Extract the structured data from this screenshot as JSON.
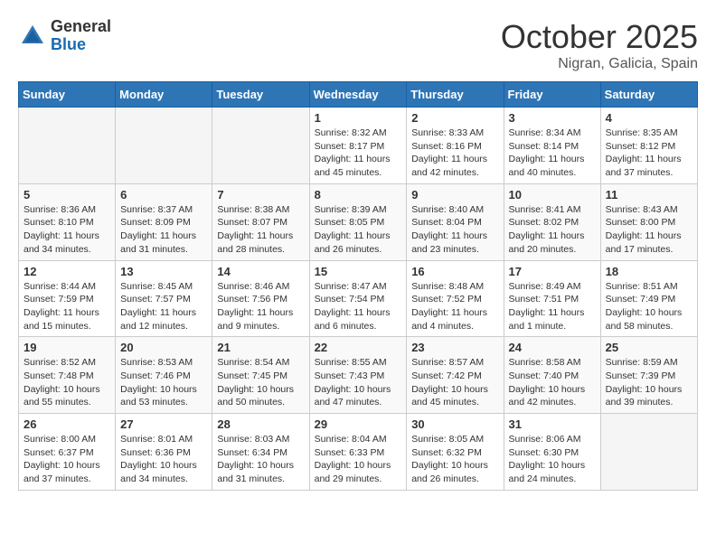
{
  "header": {
    "logo": {
      "general": "General",
      "blue": "Blue"
    },
    "title": "October 2025",
    "location": "Nigran, Galicia, Spain"
  },
  "weekdays": [
    "Sunday",
    "Monday",
    "Tuesday",
    "Wednesday",
    "Thursday",
    "Friday",
    "Saturday"
  ],
  "weeks": [
    [
      {
        "day": "",
        "info": ""
      },
      {
        "day": "",
        "info": ""
      },
      {
        "day": "",
        "info": ""
      },
      {
        "day": "1",
        "info": "Sunrise: 8:32 AM\nSunset: 8:17 PM\nDaylight: 11 hours and 45 minutes."
      },
      {
        "day": "2",
        "info": "Sunrise: 8:33 AM\nSunset: 8:16 PM\nDaylight: 11 hours and 42 minutes."
      },
      {
        "day": "3",
        "info": "Sunrise: 8:34 AM\nSunset: 8:14 PM\nDaylight: 11 hours and 40 minutes."
      },
      {
        "day": "4",
        "info": "Sunrise: 8:35 AM\nSunset: 8:12 PM\nDaylight: 11 hours and 37 minutes."
      }
    ],
    [
      {
        "day": "5",
        "info": "Sunrise: 8:36 AM\nSunset: 8:10 PM\nDaylight: 11 hours and 34 minutes."
      },
      {
        "day": "6",
        "info": "Sunrise: 8:37 AM\nSunset: 8:09 PM\nDaylight: 11 hours and 31 minutes."
      },
      {
        "day": "7",
        "info": "Sunrise: 8:38 AM\nSunset: 8:07 PM\nDaylight: 11 hours and 28 minutes."
      },
      {
        "day": "8",
        "info": "Sunrise: 8:39 AM\nSunset: 8:05 PM\nDaylight: 11 hours and 26 minutes."
      },
      {
        "day": "9",
        "info": "Sunrise: 8:40 AM\nSunset: 8:04 PM\nDaylight: 11 hours and 23 minutes."
      },
      {
        "day": "10",
        "info": "Sunrise: 8:41 AM\nSunset: 8:02 PM\nDaylight: 11 hours and 20 minutes."
      },
      {
        "day": "11",
        "info": "Sunrise: 8:43 AM\nSunset: 8:00 PM\nDaylight: 11 hours and 17 minutes."
      }
    ],
    [
      {
        "day": "12",
        "info": "Sunrise: 8:44 AM\nSunset: 7:59 PM\nDaylight: 11 hours and 15 minutes."
      },
      {
        "day": "13",
        "info": "Sunrise: 8:45 AM\nSunset: 7:57 PM\nDaylight: 11 hours and 12 minutes."
      },
      {
        "day": "14",
        "info": "Sunrise: 8:46 AM\nSunset: 7:56 PM\nDaylight: 11 hours and 9 minutes."
      },
      {
        "day": "15",
        "info": "Sunrise: 8:47 AM\nSunset: 7:54 PM\nDaylight: 11 hours and 6 minutes."
      },
      {
        "day": "16",
        "info": "Sunrise: 8:48 AM\nSunset: 7:52 PM\nDaylight: 11 hours and 4 minutes."
      },
      {
        "day": "17",
        "info": "Sunrise: 8:49 AM\nSunset: 7:51 PM\nDaylight: 11 hours and 1 minute."
      },
      {
        "day": "18",
        "info": "Sunrise: 8:51 AM\nSunset: 7:49 PM\nDaylight: 10 hours and 58 minutes."
      }
    ],
    [
      {
        "day": "19",
        "info": "Sunrise: 8:52 AM\nSunset: 7:48 PM\nDaylight: 10 hours and 55 minutes."
      },
      {
        "day": "20",
        "info": "Sunrise: 8:53 AM\nSunset: 7:46 PM\nDaylight: 10 hours and 53 minutes."
      },
      {
        "day": "21",
        "info": "Sunrise: 8:54 AM\nSunset: 7:45 PM\nDaylight: 10 hours and 50 minutes."
      },
      {
        "day": "22",
        "info": "Sunrise: 8:55 AM\nSunset: 7:43 PM\nDaylight: 10 hours and 47 minutes."
      },
      {
        "day": "23",
        "info": "Sunrise: 8:57 AM\nSunset: 7:42 PM\nDaylight: 10 hours and 45 minutes."
      },
      {
        "day": "24",
        "info": "Sunrise: 8:58 AM\nSunset: 7:40 PM\nDaylight: 10 hours and 42 minutes."
      },
      {
        "day": "25",
        "info": "Sunrise: 8:59 AM\nSunset: 7:39 PM\nDaylight: 10 hours and 39 minutes."
      }
    ],
    [
      {
        "day": "26",
        "info": "Sunrise: 8:00 AM\nSunset: 6:37 PM\nDaylight: 10 hours and 37 minutes."
      },
      {
        "day": "27",
        "info": "Sunrise: 8:01 AM\nSunset: 6:36 PM\nDaylight: 10 hours and 34 minutes."
      },
      {
        "day": "28",
        "info": "Sunrise: 8:03 AM\nSunset: 6:34 PM\nDaylight: 10 hours and 31 minutes."
      },
      {
        "day": "29",
        "info": "Sunrise: 8:04 AM\nSunset: 6:33 PM\nDaylight: 10 hours and 29 minutes."
      },
      {
        "day": "30",
        "info": "Sunrise: 8:05 AM\nSunset: 6:32 PM\nDaylight: 10 hours and 26 minutes."
      },
      {
        "day": "31",
        "info": "Sunrise: 8:06 AM\nSunset: 6:30 PM\nDaylight: 10 hours and 24 minutes."
      },
      {
        "day": "",
        "info": ""
      }
    ]
  ]
}
